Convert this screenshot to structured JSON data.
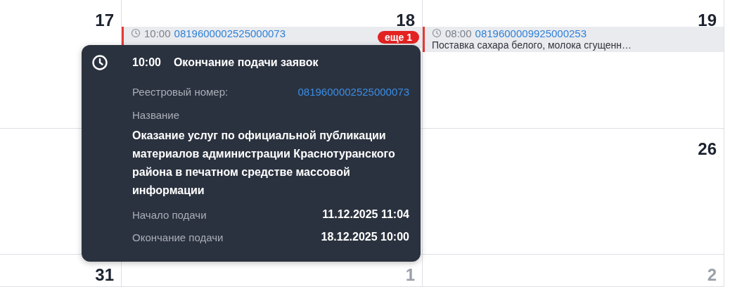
{
  "calendar": {
    "weeks": [
      {
        "days": [
          {
            "number": "17",
            "muted": false
          },
          {
            "number": "18",
            "muted": false,
            "events": [
              {
                "time": "10:00",
                "reg_number": "0819600002525000073"
              }
            ],
            "more": "еще 1"
          },
          {
            "number": "19",
            "muted": false,
            "events": [
              {
                "time": "08:00",
                "reg_number": "0819600009925000253",
                "title": "Поставка сахара белого, молока сгущенн…"
              }
            ]
          }
        ]
      },
      {
        "days": [
          {
            "number": "26",
            "muted": false
          }
        ]
      },
      {
        "days": [
          {
            "number": "31",
            "muted": false
          },
          {
            "number": "1",
            "muted": true
          },
          {
            "number": "2",
            "muted": true
          }
        ]
      }
    ]
  },
  "tooltip": {
    "time": "10:00",
    "heading": "Окончание подачи заявок",
    "reg_label": "Реестровый номер:",
    "reg_number": "0819600002525000073",
    "name_label": "Название",
    "name": "Оказание услуг по официальной публикации материалов администрации Краснотуранского района в печатном средстве массовой информации",
    "fields": [
      {
        "label": "Начало подачи",
        "value": "11.12.2025 11:04"
      },
      {
        "label": "Окончание подачи",
        "value": "18.12.2025 10:00"
      }
    ]
  }
}
